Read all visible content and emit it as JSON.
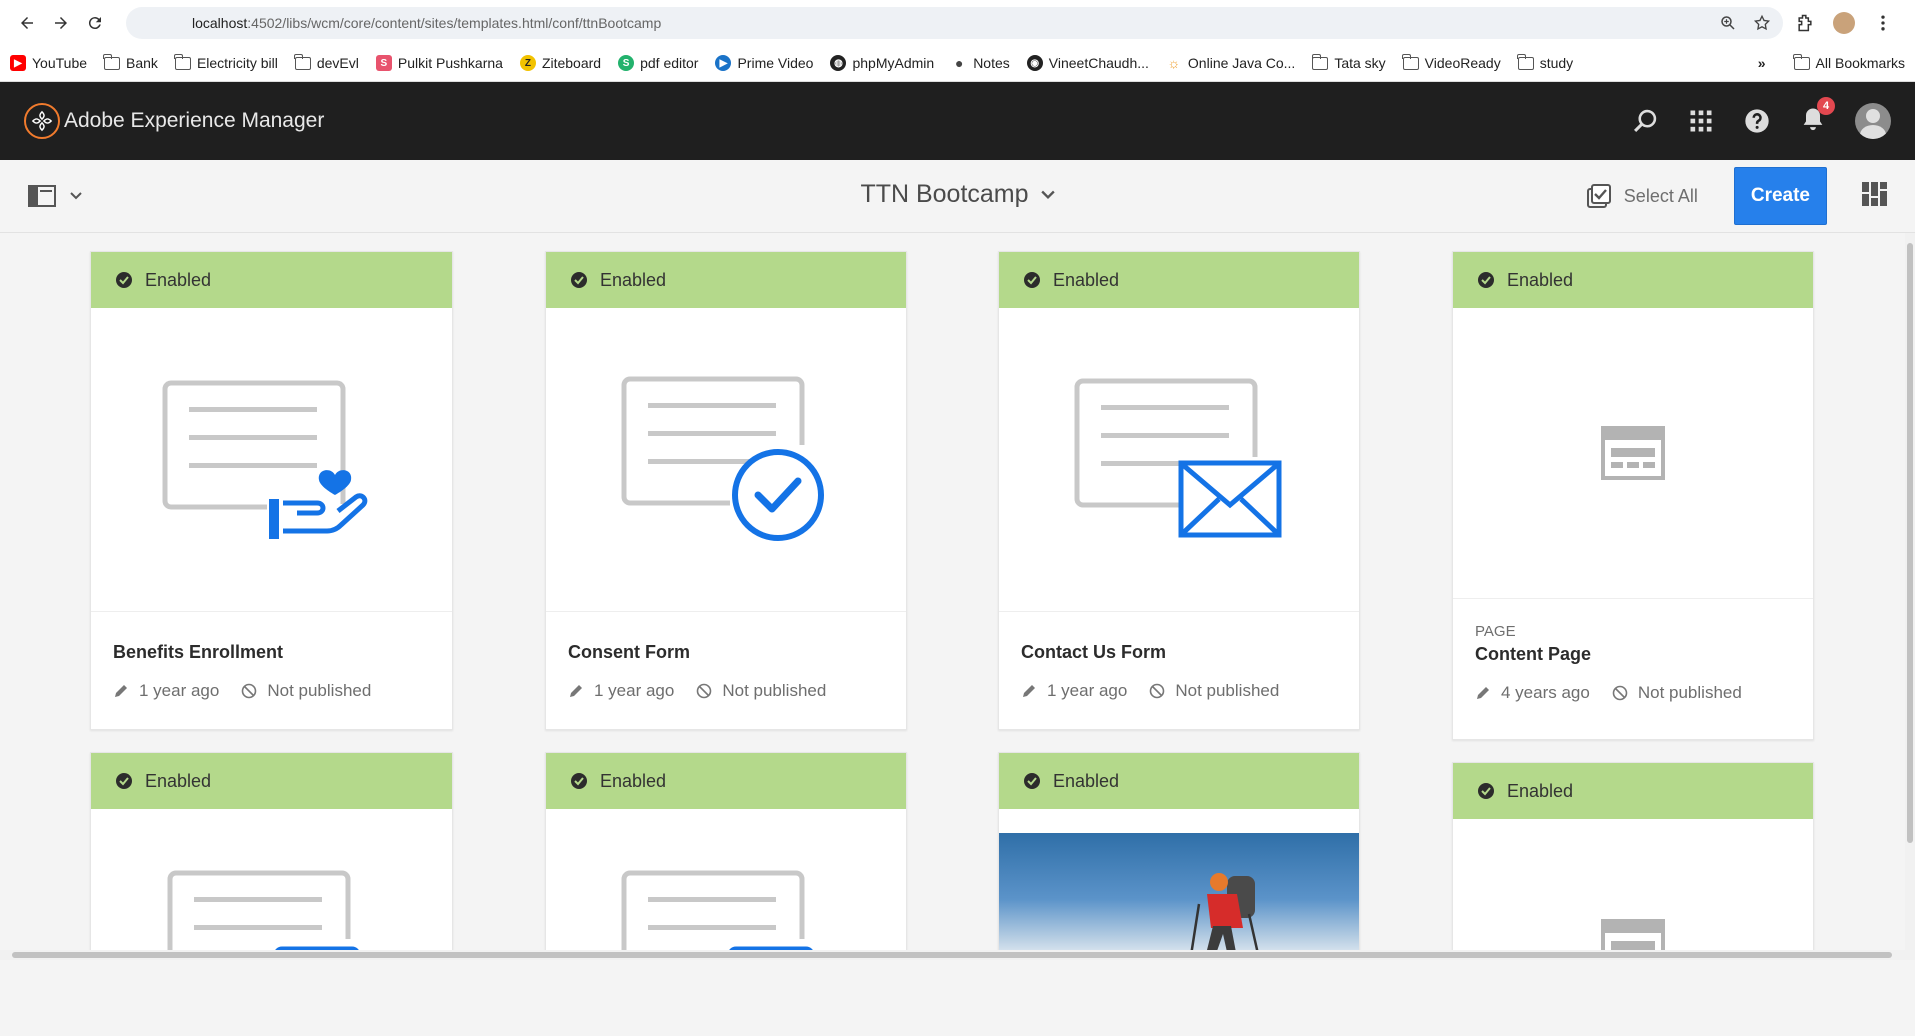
{
  "browser": {
    "url_host": "localhost",
    "url_rest": ":4502/libs/wcm/core/content/sites/templates.html/conf/ttnBootcamp",
    "bookmarks": [
      {
        "label": "YouTube",
        "icon": "youtube-icon"
      },
      {
        "label": "Bank",
        "icon": "folder-icon"
      },
      {
        "label": "Electricity bill",
        "icon": "folder-icon"
      },
      {
        "label": "devEvl",
        "icon": "folder-icon"
      },
      {
        "label": "Pulkit Pushkarna",
        "icon": "s-icon"
      },
      {
        "label": "Ziteboard",
        "icon": "z-icon"
      },
      {
        "label": "pdf editor",
        "icon": "s-green-icon"
      },
      {
        "label": "Prime Video",
        "icon": "play-icon"
      },
      {
        "label": "phpMyAdmin",
        "icon": "globe-icon"
      },
      {
        "label": "Notes",
        "icon": "apple-icon"
      },
      {
        "label": "VineetChaudh...",
        "icon": "github-icon"
      },
      {
        "label": "Online Java Co...",
        "icon": "sun-icon"
      },
      {
        "label": "Tata sky",
        "icon": "folder-icon"
      },
      {
        "label": "VideoReady",
        "icon": "folder-icon"
      },
      {
        "label": "study",
        "icon": "folder-icon"
      }
    ],
    "more_label": "»",
    "all_bookmarks": "All Bookmarks"
  },
  "app": {
    "brand": "Adobe Experience Manager",
    "notification_count": "4"
  },
  "actionbar": {
    "title": "TTN Bootcamp",
    "select_all": "Select All",
    "create": "Create"
  },
  "cards": [
    {
      "status": "Enabled",
      "name": "Benefits Enrollment",
      "type": "",
      "modified": "1 year ago",
      "published": "Not published",
      "thumb": "heart-hand"
    },
    {
      "status": "Enabled",
      "name": "Consent Form",
      "type": "",
      "modified": "1 year ago",
      "published": "Not published",
      "thumb": "checkmark"
    },
    {
      "status": "Enabled",
      "name": "Contact Us Form",
      "type": "",
      "modified": "1 year ago",
      "published": "Not published",
      "thumb": "envelope"
    },
    {
      "status": "Enabled",
      "name": "Content Page",
      "type": "PAGE",
      "modified": "4 years ago",
      "published": "Not published",
      "thumb": "page"
    },
    {
      "status": "Enabled",
      "thumb": "thumbs-up"
    },
    {
      "status": "Enabled",
      "thumb": "wrench"
    },
    {
      "status": "Enabled",
      "thumb": "photo"
    },
    {
      "status": "Enabled",
      "thumb": "page"
    }
  ],
  "colors": {
    "status_green": "#b4d98b",
    "accent_blue": "#2680eb",
    "icon_blue": "#1473e6",
    "topbar": "#1f1f1f"
  }
}
